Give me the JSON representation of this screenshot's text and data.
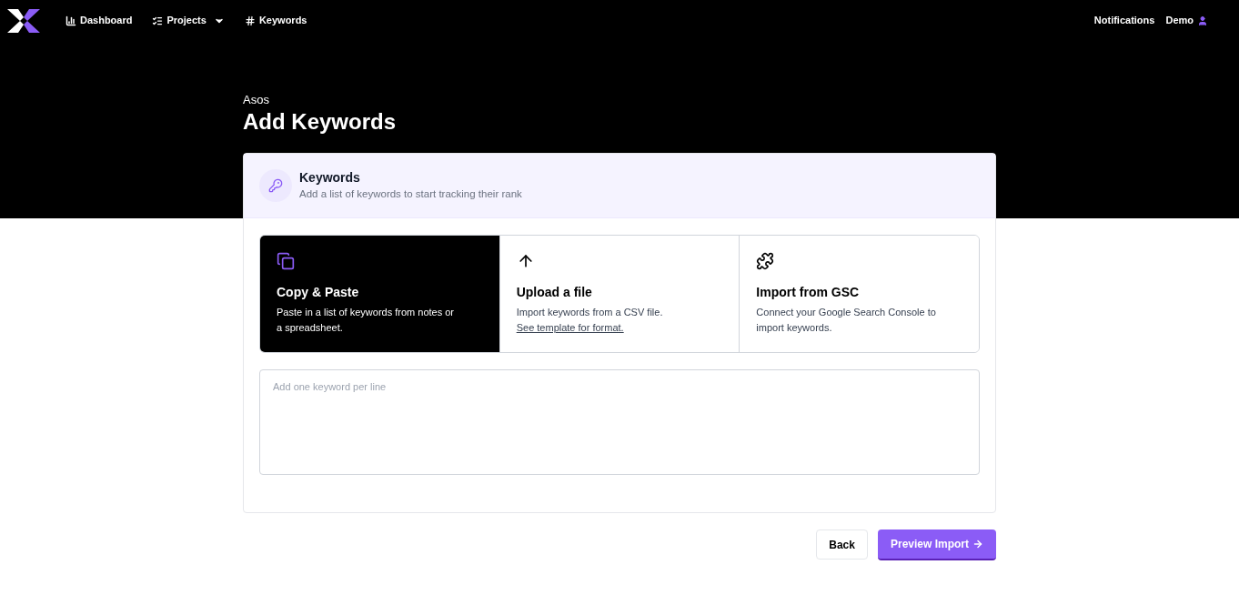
{
  "nav": {
    "items": [
      {
        "label": "Dashboard",
        "kind": "chart"
      },
      {
        "label": "Projects",
        "kind": "list",
        "dropdown": true
      },
      {
        "label": "Keywords",
        "kind": "hash"
      }
    ],
    "right": {
      "notifications": "Notifications",
      "user": "Demo"
    }
  },
  "page": {
    "project": "Asos",
    "title": "Add Keywords"
  },
  "card": {
    "title": "Keywords",
    "subtitle": "Add a list of keywords to start tracking their rank",
    "options": [
      {
        "kind": "paste",
        "title": "Copy & Paste",
        "description": "Paste in a list of keywords from notes or a spreadsheet.",
        "selected": true
      },
      {
        "kind": "upload",
        "title": "Upload a file",
        "description": "Import keywords from a CSV file.",
        "link": "See template for format.",
        "selected": false
      },
      {
        "kind": "gsc",
        "title": "Import from GSC",
        "description": "Connect your Google Search Console to import keywords.",
        "selected": false
      }
    ],
    "textarea": {
      "placeholder": "Add one keyword per line"
    }
  },
  "buttons": {
    "back": "Back",
    "primary": "Preview Import"
  }
}
